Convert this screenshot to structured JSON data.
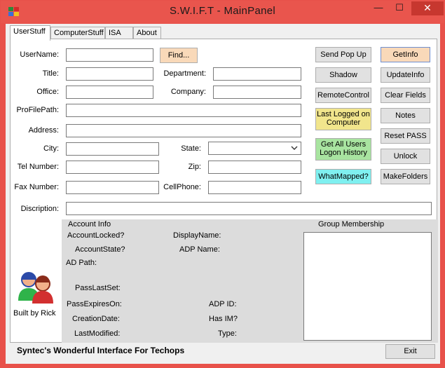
{
  "window": {
    "title": "S.W.I.F.T - MainPanel",
    "minimize": "—",
    "maximize": "☐",
    "close": "✕"
  },
  "tabs": [
    {
      "label": "UserStuff",
      "active": true
    },
    {
      "label": "ComputerStuff",
      "active": false
    },
    {
      "label": "ISA",
      "active": false
    },
    {
      "label": "About",
      "active": false
    }
  ],
  "form": {
    "username": "UserName:",
    "find": "Find...",
    "title": "Title:",
    "department": "Department:",
    "office": "Office:",
    "company": "Company:",
    "profilepath": "ProFilePath:",
    "address": "Address:",
    "city": "City:",
    "state": "State:",
    "tel": "Tel Number:",
    "zip": "Zip:",
    "fax": "Fax Number:",
    "cellphone": "CellPhone:",
    "description": "Discription:"
  },
  "buttons": {
    "send_popup": "Send Pop Up",
    "getinfo": "GetInfo",
    "shadow": "Shadow",
    "updateinfo": "UpdateInfo",
    "remotecontrol": "RemoteControl",
    "clear_fields": "Clear Fields",
    "last_logged": "Last Logged on Computer",
    "notes": "Notes",
    "reset_pass": "Reset PASS",
    "get_all_users": "Get All Users Logon History",
    "unlock": "Unlock",
    "whatmapped": "WhatMapped?",
    "makefolders": "MakeFolders",
    "exit": "Exit"
  },
  "account_info": {
    "header": "Account Info",
    "account_locked": "AccountLocked?",
    "display_name": "DisplayName:",
    "account_state": "AccountState?",
    "adp_name": "ADP Name:",
    "ad_path": "AD Path:",
    "pass_last_set": "PassLastSet:",
    "pass_expires_on": "PassExpiresOn:",
    "adp_id": "ADP ID:",
    "creation_date": "CreationDate:",
    "has_im": "Has IM?",
    "last_modified": "LastModified:",
    "type": "Type:"
  },
  "group_membership": {
    "header": "Group Membership"
  },
  "branding": {
    "built_by": "Built by Rick",
    "tagline": "Syntec's Wonderful Interface For Techops"
  },
  "colors": {
    "titlebar": "#e9554d",
    "find": "#f9d9b9",
    "getinfo": "#f9d9b9",
    "last_logged": "#f1e58c",
    "get_all_users": "#a8e4a0",
    "whatmapped": "#7ff0f0",
    "info_bg": "#dcdcdc"
  }
}
